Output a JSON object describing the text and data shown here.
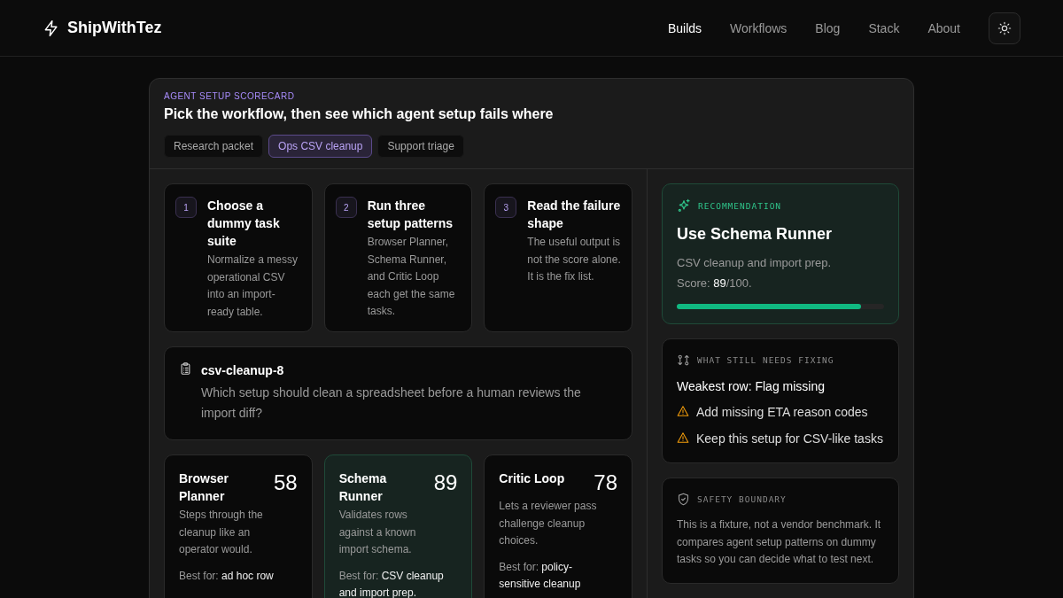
{
  "header": {
    "brand": "ShipWithTez",
    "nav": [
      {
        "label": "Builds",
        "selected": true
      },
      {
        "label": "Workflows",
        "selected": false
      },
      {
        "label": "Blog",
        "selected": false
      },
      {
        "label": "Stack",
        "selected": false
      },
      {
        "label": "About",
        "selected": false
      }
    ]
  },
  "scorecard": {
    "eyebrow": "AGENT SETUP SCORECARD",
    "title": "Pick the workflow, then see which agent setup fails where",
    "tabs": [
      {
        "label": "Research packet",
        "selected": false
      },
      {
        "label": "Ops CSV cleanup",
        "selected": true
      },
      {
        "label": "Support triage",
        "selected": false
      }
    ],
    "steps": [
      {
        "number": "1",
        "title": "Choose a dummy task suite",
        "text": "Normalize a messy operational CSV into an import-ready table."
      },
      {
        "number": "2",
        "title": "Run three setup patterns",
        "text": "Browser Planner, Schema Runner, and Critic Loop each get the same tasks."
      },
      {
        "number": "3",
        "title": "Read the failure shape",
        "text": "The useful output is not the score alone. It is the fix list."
      }
    ],
    "task": {
      "id": "csv-cleanup-8",
      "question": "Which setup should clean a spreadsheet before a human reviews the import diff?"
    },
    "agents": [
      {
        "name": "Browser Planner",
        "score": "58",
        "description": "Steps through the cleanup like an operator would.",
        "best_for_label": "Best for:",
        "best_for": "ad hoc row",
        "selected": false
      },
      {
        "name": "Schema Runner",
        "score": "89",
        "description": "Validates rows against a known import schema.",
        "best_for_label": "Best for:",
        "best_for": "CSV cleanup and import prep.",
        "selected": true
      },
      {
        "name": "Critic Loop",
        "score": "78",
        "description": "Lets a reviewer pass challenge cleanup choices.",
        "best_for_label": "Best for:",
        "best_for": "policy-sensitive cleanup",
        "selected": false
      }
    ],
    "recommendation": {
      "eyebrow": "RECOMMENDATION",
      "title": "Use Schema Runner",
      "summary": "CSV cleanup and import prep.",
      "score": "Score: **89**/100.",
      "level": 0.89
    },
    "fixes": {
      "eyebrow": "WHAT STILL NEEDS FIXING",
      "weakest": "Weakest row: Flag missing",
      "items": [
        "Add missing ETA reason codes",
        "Keep this setup for CSV-like tasks"
      ]
    },
    "safety": {
      "eyebrow": "SAFETY BOUNDARY",
      "text": "This is a fixture, not a vendor benchmark. It compares agent setup patterns on dummy tasks so you can decide what to test next."
    }
  }
}
